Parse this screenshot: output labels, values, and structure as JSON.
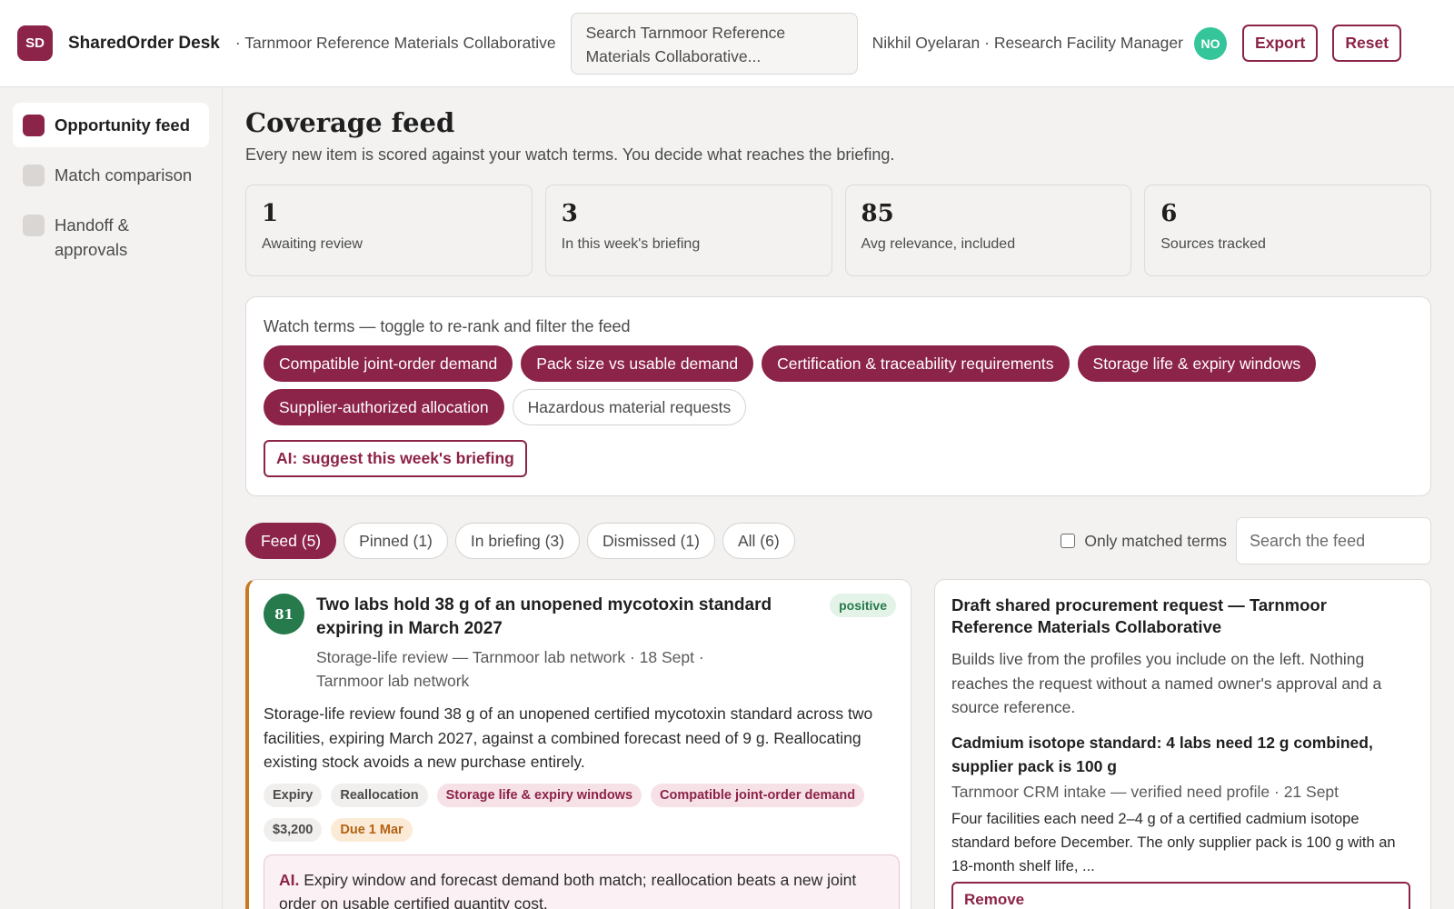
{
  "header": {
    "logo_text": "SD",
    "app_title": "SharedOrder Desk",
    "org_name": "· Tarnmoor Reference Materials Collaborative",
    "search_placeholder": "Search Tarnmoor Reference Materials Collaborative...",
    "user_label": "Nikhil Oyelaran · Research Facility Manager",
    "avatar_initials": "NO",
    "export_label": "Export",
    "reset_label": "Reset",
    "brand_color": "#8c2348",
    "avatar_color": "#35c59a"
  },
  "sidebar": {
    "items": [
      {
        "label": "Opportunity feed",
        "active": true
      },
      {
        "label": "Match comparison",
        "active": false
      },
      {
        "label": "Handoff & approvals",
        "active": false
      }
    ]
  },
  "main": {
    "title": "Coverage feed",
    "subtitle": "Every new item is scored against your watch terms. You decide what reaches the briefing.",
    "stats": [
      {
        "value": "1",
        "label": "Awaiting review"
      },
      {
        "value": "3",
        "label": "In this week's briefing"
      },
      {
        "value": "85",
        "label": "Avg relevance, included"
      },
      {
        "value": "6",
        "label": "Sources tracked"
      }
    ],
    "watch": {
      "label": "Watch terms — toggle to re-rank and filter the feed",
      "terms": [
        {
          "label": "Compatible joint-order demand",
          "on": true
        },
        {
          "label": "Pack size vs usable demand",
          "on": true
        },
        {
          "label": "Certification & traceability requirements",
          "on": true
        },
        {
          "label": "Storage life & expiry windows",
          "on": true
        },
        {
          "label": "Supplier-authorized allocation",
          "on": true
        },
        {
          "label": "Hazardous material requests",
          "on": false
        }
      ],
      "ai_button": "AI: suggest this week's briefing"
    },
    "tabs": [
      {
        "label": "Feed (5)",
        "active": true
      },
      {
        "label": "Pinned (1)",
        "active": false
      },
      {
        "label": "In briefing (3)",
        "active": false
      },
      {
        "label": "Dismissed (1)",
        "active": false
      },
      {
        "label": "All (6)",
        "active": false
      }
    ],
    "only_matched_label": "Only matched terms",
    "feed_search_placeholder": "Search the feed"
  },
  "feed_card": {
    "score": "81",
    "title": "Two labs hold 38 g of an unopened mycotoxin standard expiring in March 2027",
    "sentiment": "positive",
    "meta": "Storage-life review — Tarnmoor lab network · 18 Sept · Tarnmoor lab network",
    "body": "Storage-life review found 38 g of an unopened certified mycotoxin standard across two facilities, expiring March 2027, against a combined forecast need of 9 g. Reallocating existing stock avoids a new purchase entirely.",
    "tags": [
      "Expiry",
      "Reallocation"
    ],
    "watch_tags": [
      "Storage life & expiry windows",
      "Compatible joint-order demand"
    ],
    "value_tag": "$3,200",
    "due_tag": "Due 1 Mar",
    "ai_prefix": "AI.",
    "ai_text": "Expiry window and forecast demand both match; reallocation beats a new joint order on usable certified quantity cost.",
    "accent_color": "#c8781f",
    "score_color": "#267a4b"
  },
  "draft": {
    "title": "Draft shared procurement request — Tarnmoor Reference Materials Collaborative",
    "description": "Builds live from the profiles you include on the left. Nothing reaches the request without a named owner's approval and a source reference.",
    "item_title": "Cadmium isotope standard: 4 labs need 12 g combined, supplier pack is 100 g",
    "item_meta": "Tarnmoor CRM intake — verified need profile · 21 Sept",
    "item_body": "Four facilities each need 2–4 g of a certified cadmium isotope standard before December. The only supplier pack is 100 g with an 18-month shelf life, ...",
    "remove_label": "Remove"
  }
}
